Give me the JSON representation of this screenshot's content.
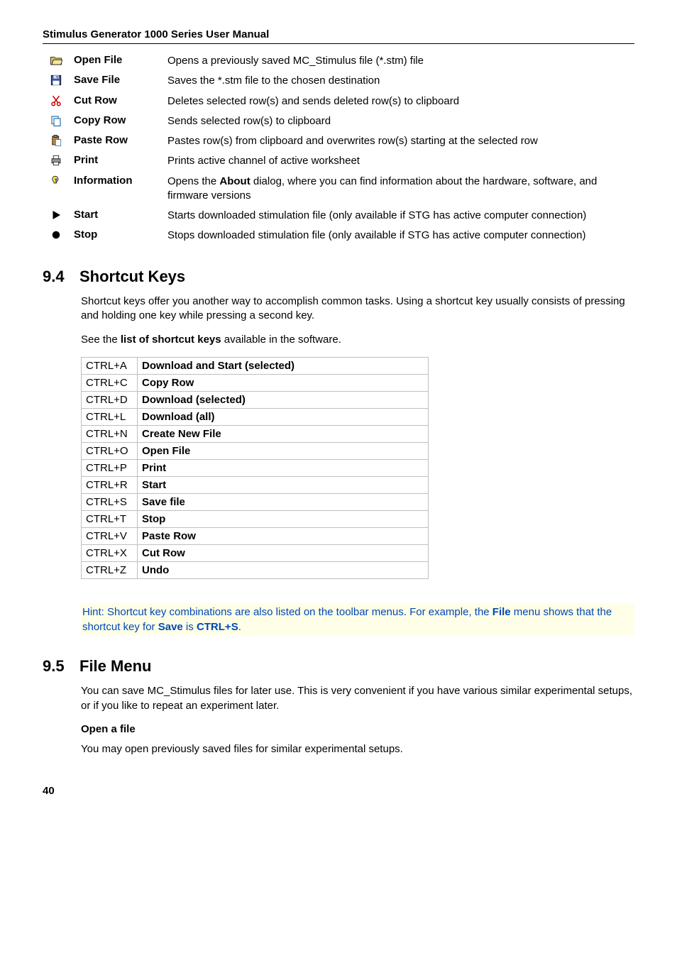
{
  "header": {
    "title": "Stimulus Generator 1000 Series User Manual"
  },
  "toolbar": [
    {
      "icon": "open",
      "label": "Open File",
      "desc": "Opens a previously saved MC_Stimulus file (*.stm) file"
    },
    {
      "icon": "save",
      "label": "Save File",
      "desc": "Saves the *.stm file to the chosen destination"
    },
    {
      "icon": "cut",
      "label": "Cut Row",
      "desc": "Deletes selected row(s) and sends deleted row(s) to clipboard"
    },
    {
      "icon": "copy",
      "label": "Copy Row",
      "desc": "Sends selected row(s) to clipboard"
    },
    {
      "icon": "paste",
      "label": "Paste Row",
      "desc": "Pastes row(s) from clipboard and overwrites row(s) starting at the selected row"
    },
    {
      "icon": "print",
      "label": "Print",
      "desc": "Prints active channel of active worksheet"
    },
    {
      "icon": "info",
      "label": "Information",
      "desc_pre": "Opens the ",
      "desc_bold": "About",
      "desc_post": " dialog, where you can find information about the hardware, software, and firmware versions"
    },
    {
      "icon": "start",
      "label": "Start",
      "desc": "Starts downloaded stimulation file (only available if STG has active computer connection)"
    },
    {
      "icon": "stop",
      "label": "Stop",
      "desc": "Stops downloaded stimulation file (only available if STG has active computer connection)"
    }
  ],
  "section94": {
    "num": "9.4",
    "title": "Shortcut Keys",
    "para1": "Shortcut keys offer you another way to accomplish common tasks. Using a shortcut key usually consists of pressing and holding one key while pressing a second key.",
    "para2_pre": "See the ",
    "para2_bold": "list of shortcut keys",
    "para2_post": " available in the software."
  },
  "shortcuts": [
    {
      "key": "CTRL+A",
      "action": "Download and Start (selected)"
    },
    {
      "key": "CTRL+C",
      "action": "Copy Row"
    },
    {
      "key": "CTRL+D",
      "action": "Download (selected)"
    },
    {
      "key": "CTRL+L",
      "action": "Download (all)"
    },
    {
      "key": "CTRL+N",
      "action": "Create New File"
    },
    {
      "key": "CTRL+O",
      "action": "Open File"
    },
    {
      "key": "CTRL+P",
      "action": "Print"
    },
    {
      "key": "CTRL+R",
      "action": "Start"
    },
    {
      "key": "CTRL+S",
      "action": "Save file"
    },
    {
      "key": "CTRL+T",
      "action": "Stop"
    },
    {
      "key": "CTRL+V",
      "action": "Paste Row"
    },
    {
      "key": "CTRL+X",
      "action": "Cut Row"
    },
    {
      "key": "CTRL+Z",
      "action": "Undo"
    }
  ],
  "hint": {
    "pre": "Hint: Shortcut key combinations are also listed on the toolbar menus. For example, the ",
    "b1": "File",
    "mid": " menu shows that the shortcut key for ",
    "b2": "Save",
    "mid2": " is ",
    "b3": "CTRL+S",
    "post": "."
  },
  "section95": {
    "num": "9.5",
    "title": "File Menu",
    "para1": "You can save MC_Stimulus files for later use. This is very convenient if you have various similar experimental setups, or if you like to repeat an experiment later.",
    "sub": "Open a file",
    "para2": "You may open previously saved files for similar experimental setups."
  },
  "pageNum": "40"
}
